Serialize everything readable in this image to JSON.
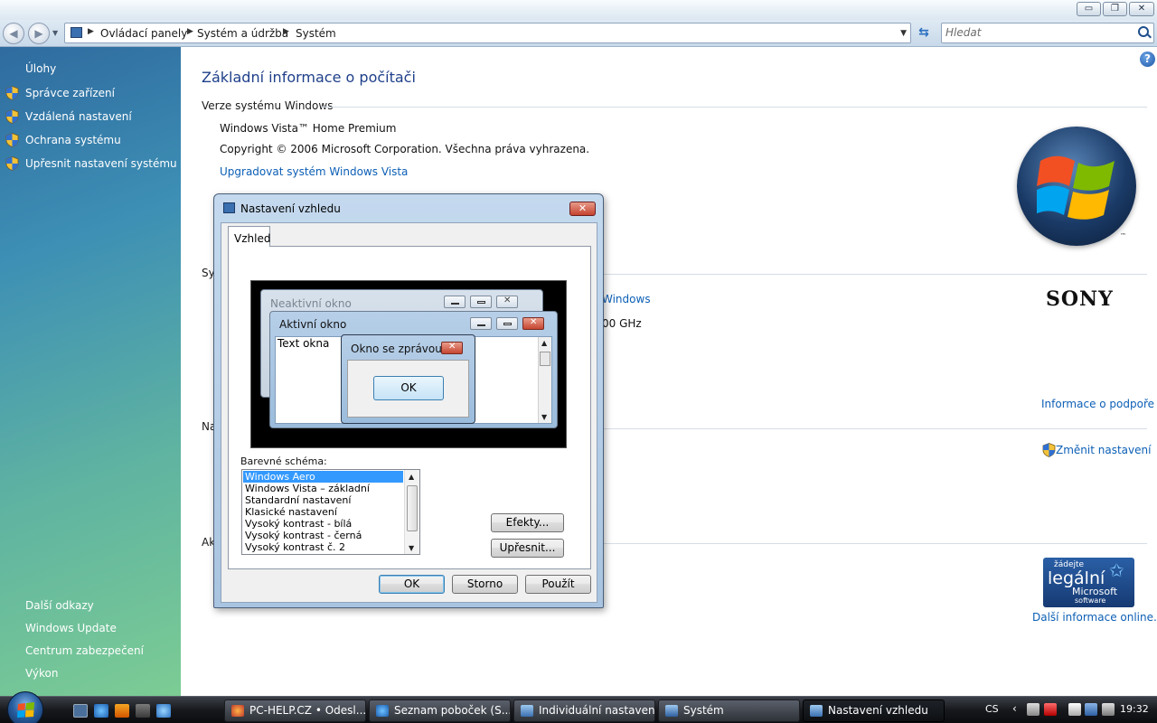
{
  "window": {
    "breadcrumb": [
      "Ovládací panely",
      "Systém a údržba",
      "Systém"
    ],
    "search_placeholder": "Hledat",
    "min_glyph": "▭",
    "max_glyph": "❐",
    "close_glyph": "✕"
  },
  "sidebar": {
    "tasks_heading": "Úlohy",
    "tasks": [
      {
        "label": "Správce zařízení",
        "icon": "shield-icon"
      },
      {
        "label": "Vzdálená nastavení",
        "icon": "shield-icon"
      },
      {
        "label": "Ochrana systému",
        "icon": "shield-icon"
      },
      {
        "label": "Upřesnit nastavení systému",
        "icon": "shield-icon"
      }
    ],
    "see_also": [
      "Další odkazy",
      "Windows Update",
      "Centrum zabezpečení",
      "Výkon"
    ]
  },
  "main": {
    "title": "Základní informace o počítači",
    "edition_heading": "Verze systému Windows",
    "edition": "Windows Vista™ Home Premium",
    "copyright": "Copyright © 2006 Microsoft Corporation. Všechna práva vyhrazena.",
    "upgrade_link": "Upgradovat systém Windows Vista",
    "partial": {
      "system_heading": "Sy",
      "rating_fragment": "Windows",
      "cpu_fragment": "00 GHz",
      "computer_name_heading": "Na",
      "activation_heading": "Ak"
    },
    "support_link": "Informace o podpoře",
    "change_settings_link": "Změnit nastavení",
    "more_info_link": "Další informace online...",
    "vista_tm": "™",
    "oem_logo": "SONY",
    "legal_logo": {
      "l1": "žádejte",
      "l2": "legální",
      "l3": "Microsoft",
      "l4": "software"
    }
  },
  "dialog": {
    "title": "Nastavení vzhledu",
    "tab": "Vzhled",
    "preview": {
      "inactive_title": "Neaktivní okno",
      "active_title": "Aktivní okno",
      "window_text": "Text okna",
      "message_title": "Okno se zprávou",
      "message_ok": "OK"
    },
    "scheme_label": "Barevné schéma:",
    "schemes": [
      "Windows Aero",
      "Windows Vista – základní",
      "Standardní nastavení",
      "Klasické nastavení",
      "Vysoký kontrast - bílá",
      "Vysoký kontrast - černá",
      "Vysoký kontrast č. 2"
    ],
    "selected_scheme": "Windows Aero",
    "effects_button": "Efekty...",
    "advanced_button": "Upřesnit...",
    "ok_button": "OK",
    "cancel_button": "Storno",
    "apply_button": "Použít"
  },
  "taskbar": {
    "buttons": [
      {
        "label": "PC-HELP.CZ • Odesl...",
        "icon": "firefox-icon"
      },
      {
        "label": "Seznam poboček (S...",
        "icon": "ie-icon"
      },
      {
        "label": "Individuální nastavení",
        "icon": "display-icon"
      },
      {
        "label": "Systém",
        "icon": "system-icon"
      },
      {
        "label": "Nastavení vzhledu",
        "icon": "appearance-icon",
        "active": true
      }
    ],
    "language": "CS",
    "clock": "19:32"
  },
  "colors": {
    "link": "#0c5fb6",
    "title": "#1e3f8a",
    "selection": "#3399ff",
    "sidebar_top": "#2f6b9f",
    "sidebar_bottom": "#7ccc94"
  }
}
